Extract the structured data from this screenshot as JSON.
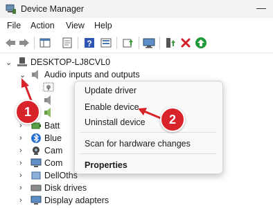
{
  "window": {
    "title": "Device Manager",
    "icon": "device-manager-icon"
  },
  "menubar": {
    "items": [
      "File",
      "Action",
      "View",
      "Help"
    ]
  },
  "toolbar": {
    "icons": [
      "back-arrow-icon",
      "forward-arrow-icon",
      "show-hide-console-tree-icon",
      "properties-icon",
      "help-icon",
      "computer-view-icon",
      "update-driver-icon",
      "scan-hardware-icon",
      "add-driver-icon",
      "uninstall-x-icon",
      "enable-device-icon"
    ]
  },
  "tree": {
    "root": "DESKTOP-LJ8CVL0",
    "expanded_category": "Audio inputs and outputs",
    "categories_partial": [
      "Batt",
      "Blue",
      "Cam",
      "Com",
      "DellOths"
    ],
    "categories": [
      "Disk drives",
      "Display adapters"
    ]
  },
  "context_menu": {
    "items": [
      "Update driver",
      "Enable device",
      "Uninstall device",
      "Scan for hardware changes",
      "Properties"
    ]
  },
  "annotations": {
    "badge1": "1",
    "badge2": "2",
    "color": "#d9232a"
  }
}
